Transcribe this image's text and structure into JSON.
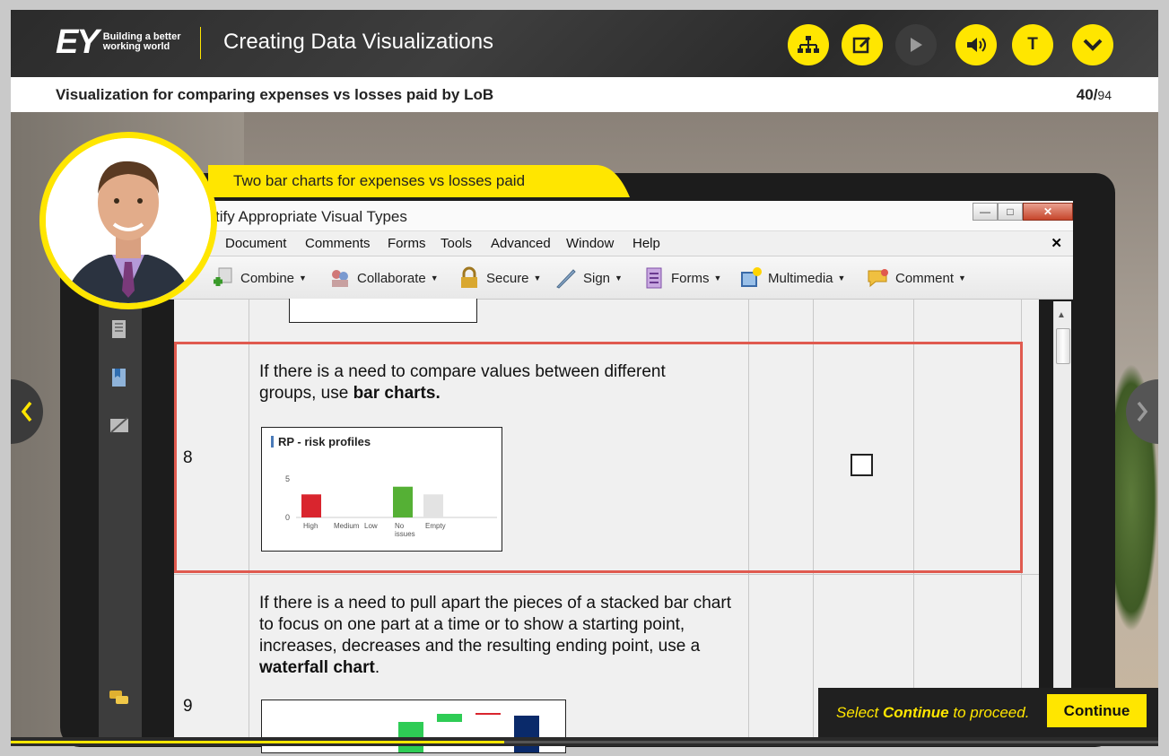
{
  "header": {
    "logo_text": "EY",
    "logo_tagline": "Building a better working world",
    "course_title": "Creating Data Visualizations",
    "buttons": [
      "sitemap-icon",
      "notes-icon",
      "play-icon",
      "audio-icon",
      "text-icon",
      "menu-chevron-icon"
    ],
    "accent_color": "#ffe600"
  },
  "subheader": {
    "slide_title": "Visualization for comparing expenses vs losses paid by LoB",
    "page_current": "40/",
    "page_total": "94"
  },
  "callout": {
    "text": "Two bar charts for expenses vs losses paid"
  },
  "window": {
    "title": "tify Appropriate Visual Types",
    "menu": [
      "Document",
      "Comments",
      "Forms",
      "Tools",
      "Advanced",
      "Window",
      "Help"
    ],
    "toolbar": [
      "Combine",
      "Collaborate",
      "Secure",
      "Sign",
      "Forms",
      "Multimedia",
      "Comment"
    ]
  },
  "document": {
    "row8": {
      "number": "8",
      "text_plain": "If there is a need to compare values between different groups, use ",
      "text_bold": "bar charts."
    },
    "row9": {
      "number": "9",
      "text_plain": "If there is a need to pull apart the pieces of a stacked bar chart to focus on one part at a time or to show a starting point, increases, decreases and the resulting ending point, use a ",
      "text_bold": "waterfall chart",
      "text_end": "."
    }
  },
  "chart_data": {
    "type": "bar",
    "title": "RP - risk profiles",
    "categories": [
      "High",
      "Medium",
      "Low",
      "No issues",
      "Empty"
    ],
    "values": [
      3,
      0,
      0,
      4,
      3
    ],
    "colors": [
      "#d9252e",
      "#ffffff",
      "#ffffff",
      "#55b035",
      "#e3e3e3"
    ],
    "y_ticks": [
      "0",
      "5"
    ],
    "ylim": [
      0,
      7
    ]
  },
  "continue_bar": {
    "text_pre": "Select ",
    "text_bold": "Continue",
    "text_post": " to proceed.",
    "button_label": "Continue"
  },
  "progress": 0.43
}
